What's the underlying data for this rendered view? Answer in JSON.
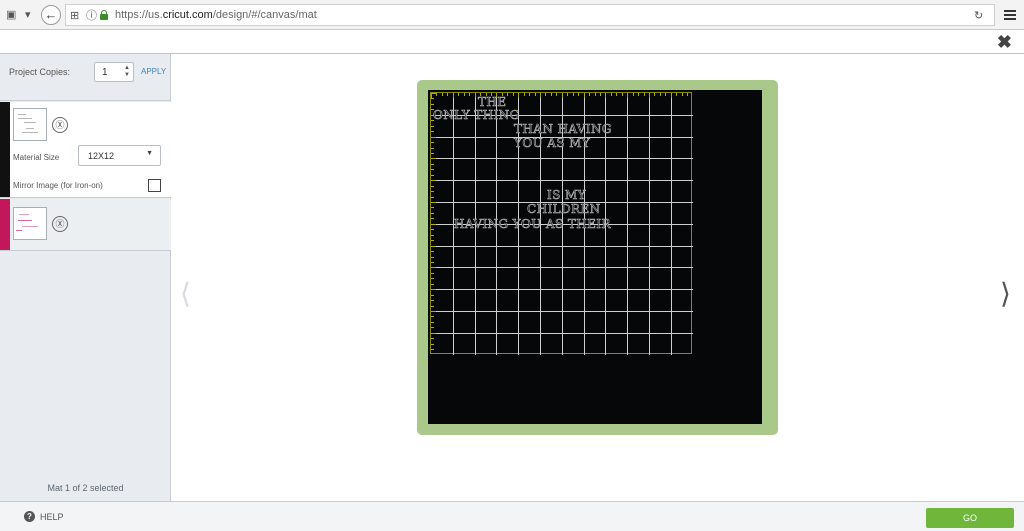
{
  "browser": {
    "url_prefix": "https://us.",
    "url_host": "cricut.com",
    "url_path": "/design/#/canvas/mat"
  },
  "icons": {
    "back": "←",
    "close": "✖",
    "refresh": "↻",
    "nav_prev": "⟨",
    "nav_next": "⟩",
    "go": "Ⓧ",
    "help": "?",
    "spin": "▲▼",
    "caret": "▼"
  },
  "sidebar": {
    "copies_label": "Project Copies:",
    "copies_value": "1",
    "apply_label": "APPLY",
    "mats": [
      {
        "color": "#111111",
        "material_size_label": "Material Size",
        "material_size_value": "12X12",
        "mirror_label": "Mirror Image (for Iron-on)"
      },
      {
        "color": "#c2185b"
      }
    ],
    "mat_count": "Mat 1 of 2 selected"
  },
  "canvas": {
    "mat_color": "#a9c88a",
    "lines": [
      "THE",
      "ONLY THING",
      "THAN HAVING",
      "YOU AS MY",
      "IS MY",
      "CHILDREN",
      "HAVING YOU AS THEIR"
    ]
  },
  "footer": {
    "help_label": "HELP",
    "go_label": "GO",
    "go_color": "#6fb63a"
  }
}
